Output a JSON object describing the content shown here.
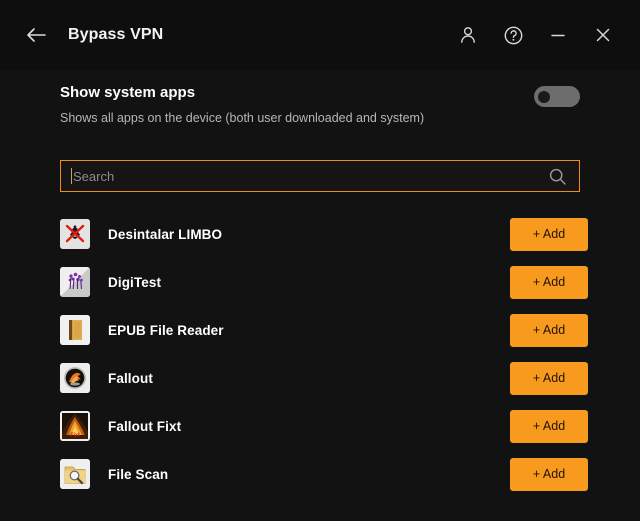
{
  "window": {
    "title": "Bypass VPN",
    "back_icon": "arrow-left-icon",
    "actions": [
      {
        "name": "account-icon",
        "glyph": "person"
      },
      {
        "name": "help-icon",
        "glyph": "question-circle"
      },
      {
        "name": "minimize-icon",
        "glyph": "dash"
      },
      {
        "name": "close-icon",
        "glyph": "cross"
      }
    ]
  },
  "setting": {
    "title": "Show system apps",
    "subtitle": "Shows all apps on the device (both user downloaded and system)",
    "toggle_state": "off"
  },
  "search": {
    "placeholder": "Search",
    "value": "",
    "icon": "search-icon"
  },
  "colors": {
    "accent": "#f79a1e",
    "border_focus": "#f08a18",
    "background": "#121212",
    "titlebar": "#0e0e0e",
    "toggle_off": "#6d6d6d"
  },
  "apps": [
    {
      "name": "Desintalar LIMBO",
      "icon": "uninstall-limbo-icon",
      "action_label": "+ Add"
    },
    {
      "name": "DigiTest",
      "icon": "digitest-icon",
      "action_label": "+ Add"
    },
    {
      "name": "EPUB File Reader",
      "icon": "epub-file-reader-icon",
      "action_label": "+ Add"
    },
    {
      "name": "Fallout",
      "icon": "fallout-icon",
      "action_label": "+ Add"
    },
    {
      "name": "Fallout Fixt",
      "icon": "fallout-fixt-icon",
      "action_label": "+ Add"
    },
    {
      "name": "File Scan",
      "icon": "file-scan-icon",
      "action_label": "+ Add"
    }
  ]
}
